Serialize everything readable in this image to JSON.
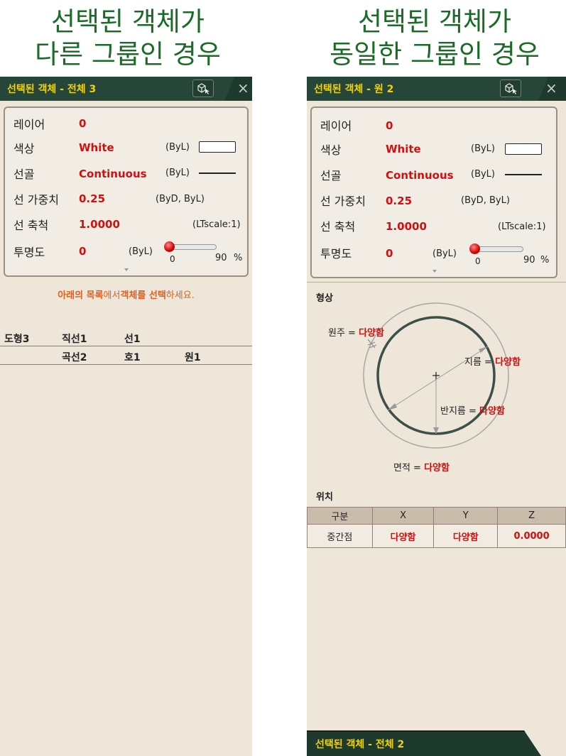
{
  "captions": {
    "left_line1": "선택된 객체가",
    "left_line2": "다른 그룹인 경우",
    "right_line1": "선택된 객체가",
    "right_line2": "동일한 그룹인 경우"
  },
  "colors": {
    "accent_yellow": "#f4d200",
    "value_red": "#d20f0f",
    "caption_green": "#1a6b26",
    "panel_bg": "#ede6d9",
    "title_bg": "#1e3a2f"
  },
  "left_panel": {
    "title": "선택된 객체 - 전체 3",
    "close_label": "×",
    "properties": {
      "layer_label": "레이어",
      "layer_value": "0",
      "color_label": "색상",
      "color_value": "White",
      "color_note": "(ByL)",
      "linetype_label": "선골",
      "linetype_value": "Continuous",
      "linetype_note": "(ByL)",
      "lineweight_label": "선 가중치",
      "lineweight_value": "0.25",
      "lineweight_note": "(ByD, ByL)",
      "linescale_label": "선 축척",
      "linescale_value": "1.0000",
      "linescale_note": "(LTscale:1)",
      "transparency_label": "투명도",
      "transparency_value": "0",
      "transparency_note": "(ByL)",
      "slider_min": "0",
      "slider_max": "90",
      "slider_unit": "%"
    },
    "instruction": {
      "part1": "아래의 목록",
      "part2": "에서",
      "part3": "객체를 선택",
      "part4": "하세요."
    },
    "groups": {
      "row1": {
        "total": "도형3",
        "item1": "직선1",
        "item2": "선1"
      },
      "row2": {
        "item1": "곡선2",
        "item2": "호1",
        "item3": "원1"
      }
    }
  },
  "right_panel": {
    "title": "선택된 객체 - 원 2",
    "close_label": "×",
    "properties": {
      "layer_label": "레이어",
      "layer_value": "0",
      "color_label": "색상",
      "color_value": "White",
      "color_note": "(ByL)",
      "linetype_label": "선골",
      "linetype_value": "Continuous",
      "linetype_note": "(ByL)",
      "lineweight_label": "선 가중치",
      "lineweight_value": "0.25",
      "lineweight_note": "(ByD, ByL)",
      "linescale_label": "선 축척",
      "linescale_value": "1.0000",
      "linescale_note": "(LTscale:1)",
      "transparency_label": "투명도",
      "transparency_value": "0",
      "transparency_note": "(ByL)",
      "slider_min": "0",
      "slider_max": "90",
      "slider_unit": "%"
    },
    "shape": {
      "section_label": "형상",
      "circumference_label": "원주 =",
      "circumference_value": "다양함",
      "diameter_label": "지름 =",
      "diameter_value": "다양함",
      "radius_label": "반지름 =",
      "radius_value": "다양함",
      "area_label": "면적 =",
      "area_value": "다양함"
    },
    "position": {
      "section_label": "위치",
      "headers": [
        "구분",
        "X",
        "Y",
        "Z"
      ],
      "row": [
        "중간점",
        "다양함",
        "다양함",
        "0.0000"
      ]
    },
    "bottom_title": "선택된 객체 - 전체 2"
  }
}
